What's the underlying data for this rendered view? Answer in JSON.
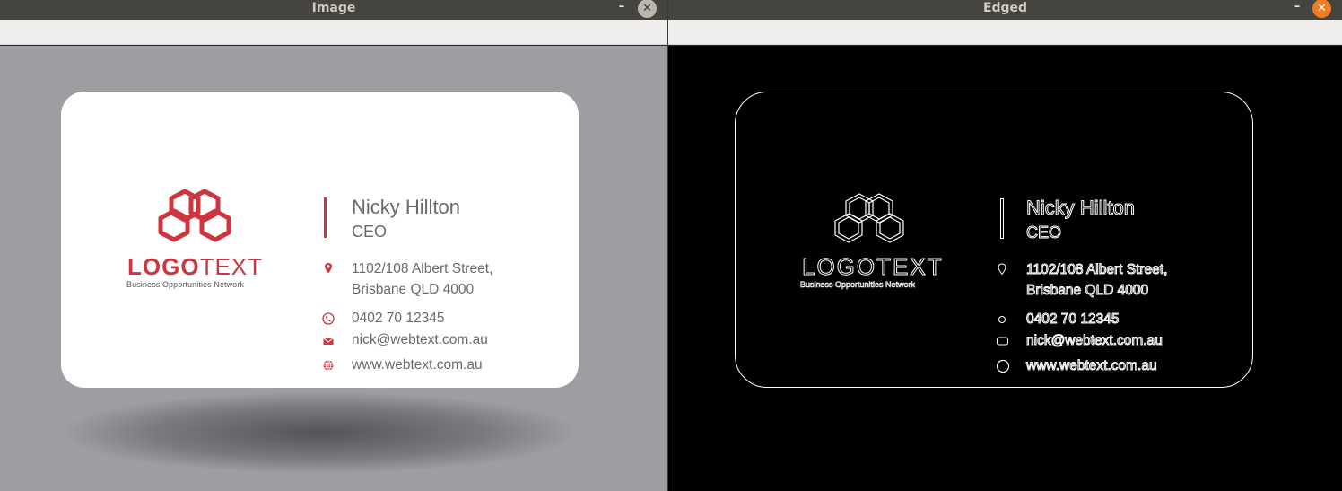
{
  "windows": {
    "left": {
      "title": "Image",
      "minimize_glyph": "–",
      "close_glyph": "✕"
    },
    "right": {
      "title": "Edged",
      "minimize_glyph": "–",
      "close_glyph": "✕"
    }
  },
  "card": {
    "logo_word_a": "LOGO",
    "logo_word_b": "TEXT",
    "tagline": "Business Opportunities Network",
    "name": "Nicky Hillton",
    "title": "CEO",
    "address_line1": "1102/108 Albert Street,",
    "address_line2": "Brisbane QLD 4000",
    "phone": "0402 70 12345",
    "email": "nick@webtext.com.au",
    "website": "www.webtext.com.au"
  },
  "icons": [
    "location-pin-icon",
    "phone-icon",
    "mail-icon",
    "globe-icon",
    "hexagon-logo-icon"
  ],
  "colors": {
    "brand_red": "#d0343e",
    "left_background": "#9d9ea2",
    "edge_background": "#000000",
    "close_button_right": "#f07d23"
  }
}
